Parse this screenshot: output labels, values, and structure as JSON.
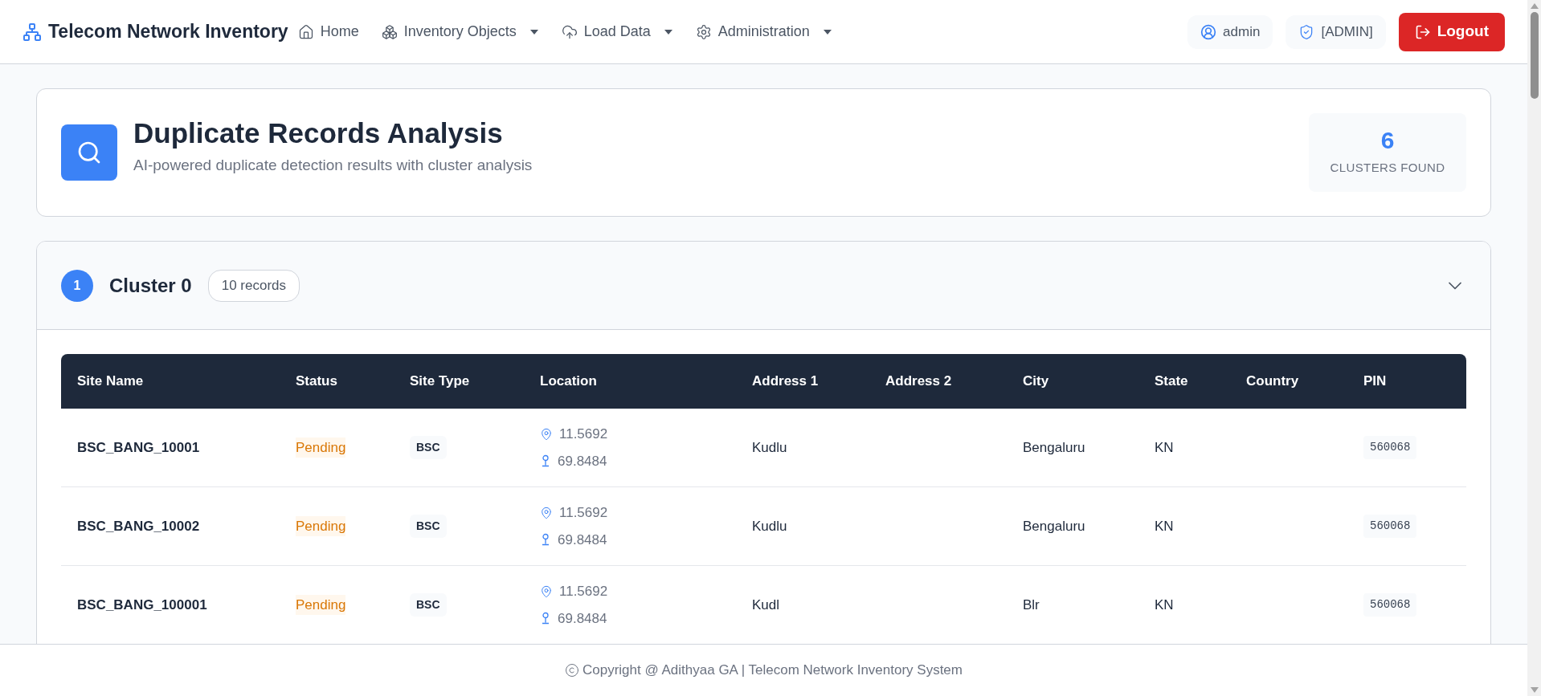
{
  "brand": {
    "title": "Telecom Network Inventory"
  },
  "nav": [
    {
      "label": "Home",
      "kind": "link"
    },
    {
      "label": "Inventory Objects",
      "kind": "dropdown"
    },
    {
      "label": "Load Data",
      "kind": "dropdown"
    },
    {
      "label": "Administration",
      "kind": "dropdown"
    }
  ],
  "user": {
    "name": "admin",
    "role": "[ADMIN]",
    "logout": "Logout"
  },
  "header": {
    "title": "Duplicate Records Analysis",
    "subtitle": "AI-powered duplicate detection results with cluster analysis",
    "count": "6",
    "count_label": "CLUSTERS FOUND"
  },
  "clusters": [
    {
      "number": "1",
      "title": "Cluster 0",
      "badge": "10 records",
      "expanded": true,
      "table": {
        "columns": [
          "Site Name",
          "Status",
          "Site Type",
          "Location",
          "Address 1",
          "Address 2",
          "City",
          "State",
          "Country",
          "PIN"
        ],
        "rows": [
          {
            "site_name": "BSC_BANG_10001",
            "status": "Pending",
            "site_type": "BSC",
            "latitude": "11.5692",
            "longitude": "69.8484",
            "address_1": "Kudlu",
            "city": "Bengaluru",
            "state": "KN",
            "pin": "560068"
          },
          {
            "site_name": "BSC_BANG_10002",
            "status": "Pending",
            "site_type": "BSC",
            "latitude": "11.5692",
            "longitude": "69.8484",
            "address_1": "Kudlu",
            "city": "Bengaluru",
            "state": "KN",
            "pin": "560068"
          },
          {
            "site_name": "BSC_BANG_100001",
            "status": "Pending",
            "site_type": "BSC",
            "latitude": "11.5692",
            "longitude": "69.8484",
            "address_1": "Kudl",
            "city": "Blr",
            "state": "KN",
            "pin": "560068"
          }
        ]
      }
    }
  ],
  "footer": {
    "text": "Copyright @ Adithyaa GA | Telecom Network Inventory System"
  }
}
